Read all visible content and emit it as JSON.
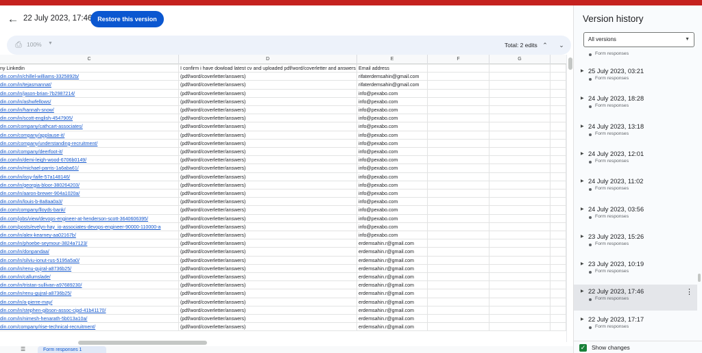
{
  "header": {
    "version_date": "22 July 2023, 17:46",
    "restore_label": "Restore this version"
  },
  "toolbar": {
    "zoom": "100%",
    "total_edits": "Total: 2 edits"
  },
  "sheet": {
    "columns": [
      "C",
      "D",
      "E",
      "F",
      "G"
    ],
    "header_row": {
      "c": "ny Linkedin",
      "d": "I confirm i have dowload latest cv and uploaded pdf/word/coverletter and answers",
      "e": "Email address"
    },
    "rows": [
      {
        "c": "din.com/in/chillel-williams-3325892b/",
        "d": "(pdf/word/coverletter/answers)",
        "e": "rifaterdemsahin@gmail.com"
      },
      {
        "c": "din.com/in/tejasmannat/",
        "d": "(pdf/word/coverletter/answers)",
        "e": "rifaterdemsahin@gmail.com"
      },
      {
        "c": "din.com/in/jason-brian-7b2987214/",
        "d": "(pdf/word/coverletter/answers)",
        "e": "info@pexabo.com"
      },
      {
        "c": "din.com/in/ashwfellows/",
        "d": "(pdf/word/coverletter/answers)",
        "e": "info@pexabo.com"
      },
      {
        "c": "din.com/in/hannah-snow/",
        "d": "(pdf/word/coverletter/answers)",
        "e": "info@pexabo.com"
      },
      {
        "c": "din.com/in/scott-english-4547905/",
        "d": "(pdf/word/coverletter/answers)",
        "e": "info@pexabo.com"
      },
      {
        "c": "din.com/company/cathcart-associates/",
        "d": "(pdf/word/coverletter/answers)",
        "e": "info@pexabo.com"
      },
      {
        "c": "din.com/company/applause-it/",
        "d": "(pdf/word/coverletter/answers)",
        "e": "info@pexabo.com"
      },
      {
        "c": "din.com/company/understanding-recruitment/",
        "d": "(pdf/word/coverletter/answers)",
        "e": "info@pexabo.com"
      },
      {
        "c": "din.com/company/deerfoot-it/",
        "d": "(pdf/word/coverletter/answers)",
        "e": "info@pexabo.com"
      },
      {
        "c": "din.com/in/demi-leigh-wood-6706b0149/",
        "d": "(pdf/word/coverletter/answers)",
        "e": "info@pexabo.com"
      },
      {
        "c": "din.com/in/michael-parris-1a6aba61/",
        "d": "(pdf/word/coverletter/answers)",
        "e": "info@pexabo.com"
      },
      {
        "c": "din.com/in/issy-faife-57a148146/",
        "d": "(pdf/word/coverletter/answers)",
        "e": "info@pexabo.com"
      },
      {
        "c": "din.com/in/georgia-bloor-380264203/",
        "d": "(pdf/word/coverletter/answers)",
        "e": "info@pexabo.com"
      },
      {
        "c": "din.com/in/aaron-brewer-904a1020a/",
        "d": "(pdf/word/coverletter/answers)",
        "e": "info@pexabo.com"
      },
      {
        "c": "din.com/in/louis-b-8a8aa0a3/",
        "d": "(pdf/word/coverletter/answers)",
        "e": "info@pexabo.com"
      },
      {
        "c": "din.com/company/lloyds-bank/",
        "d": "(pdf/word/coverletter/answers)",
        "e": "info@pexabo.com"
      },
      {
        "c": "din.com/jobs/view/devops-engineer-at-henderson-scott-3640606395/",
        "d": "(pdf/word/coverletter/answers)",
        "e": "info@pexabo.com"
      },
      {
        "c": "din.com/posts/evelyn-hay_io-associates-devops-engineer-90000-110000-a",
        "d": "(pdf/word/coverletter/answers)",
        "e": "info@pexabo.com"
      },
      {
        "c": "din.com/in/alex-kearney-aa02167b/",
        "d": "(pdf/word/coverletter/answers)",
        "e": "info@pexabo.com"
      },
      {
        "c": "din.com/in/phoebe-seymour-3824a7123/",
        "d": "(pdf/word/coverletter/answers)",
        "e": "erdemsahin.r@gmail.com"
      },
      {
        "c": "din.com/in/donpandaa/",
        "d": "(pdf/word/coverletter/answers)",
        "e": "erdemsahin.r@gmail.com"
      },
      {
        "c": "din.com/in/silviu-ionut-rus-5195a5a0/",
        "d": "(pdf/word/coverletter/answers)",
        "e": "erdemsahin.r@gmail.com"
      },
      {
        "c": "din.com/in/renu-gujral-a8736b25/",
        "d": "(pdf/word/coverletter/answers)",
        "e": "erdemsahin.r@gmail.com"
      },
      {
        "c": "din.com/in/callumslade/",
        "d": "(pdf/word/coverletter/answers)",
        "e": "erdemsahin.r@gmail.com"
      },
      {
        "c": "din.com/in/tristan-sullivan-a97689230/",
        "d": "(pdf/word/coverletter/answers)",
        "e": "erdemsahin.r@gmail.com"
      },
      {
        "c": "din.com/in/renu-gujral-a8736b25/",
        "d": "(pdf/word/coverletter/answers)",
        "e": "erdemsahin.r@gmail.com"
      },
      {
        "c": "din.com/in/a-pierre-may/",
        "d": "(pdf/word/coverletter/answers)",
        "e": "erdemsahin.r@gmail.com"
      },
      {
        "c": "din.com/in/stephen-gibson-assoc-cipd-41b41170/",
        "d": "(pdf/word/coverletter/answers)",
        "e": "erdemsahin.r@gmail.com"
      },
      {
        "c": "din.com/in/nimesh-henarath-5b013a10a/",
        "d": "(pdf/word/coverletter/answers)",
        "e": "erdemsahin.r@gmail.com"
      },
      {
        "c": "din.com/company/rise-technical-recruitment/",
        "d": "(pdf/word/coverletter/answers)",
        "e": "erdemsahin.r@gmail.com"
      }
    ],
    "tab_label": "Form responses 1"
  },
  "panel": {
    "title": "Version history",
    "filter": "All versions",
    "top_author": "Form responses",
    "versions": [
      {
        "date": "25 July 2023, 03:21",
        "author": "Form responses",
        "selected": false
      },
      {
        "date": "24 July 2023, 18:28",
        "author": "Form responses",
        "selected": false
      },
      {
        "date": "24 July 2023, 13:18",
        "author": "Form responses",
        "selected": false
      },
      {
        "date": "24 July 2023, 12:01",
        "author": "Form responses",
        "selected": false
      },
      {
        "date": "24 July 2023, 11:02",
        "author": "Form responses",
        "selected": false
      },
      {
        "date": "24 July 2023, 03:56",
        "author": "Form responses",
        "selected": false
      },
      {
        "date": "23 July 2023, 15:26",
        "author": "Form responses",
        "selected": false
      },
      {
        "date": "23 July 2023, 10:19",
        "author": "Form responses",
        "selected": false
      },
      {
        "date": "22 July 2023, 17:46",
        "author": "Form responses",
        "selected": true
      },
      {
        "date": "22 July 2023, 17:17",
        "author": "Form responses",
        "selected": false
      }
    ],
    "show_changes_label": "Show changes"
  },
  "icons": {
    "back": "arrow-left-icon",
    "print": "printer-icon",
    "up": "chevron-up-icon",
    "down": "chevron-down-icon",
    "more": "more-vert-icon"
  },
  "colors": {
    "accent": "#0b57d0",
    "link": "#1155cc",
    "checkbox": "#188038"
  }
}
